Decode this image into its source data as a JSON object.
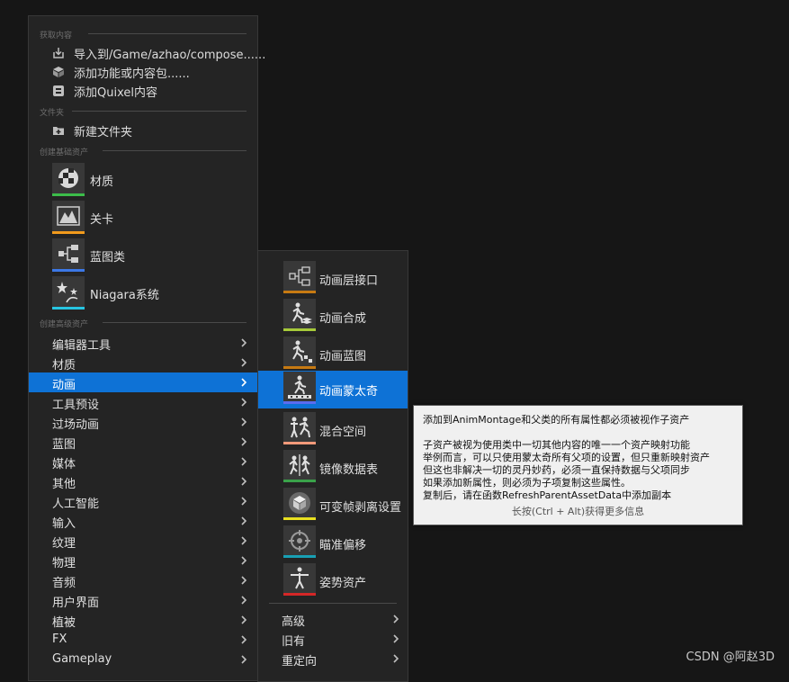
{
  "main_menu": {
    "sections": {
      "get_content": "获取内容",
      "folder": "文件夹",
      "basic_assets": "创建基础资产",
      "advanced_assets": "创建高级资产"
    },
    "get_content_items": [
      {
        "label": "导入到/Game/azhao/compose......",
        "icon": "import-icon"
      },
      {
        "label": "添加功能或内容包......",
        "icon": "feature-pack-icon"
      },
      {
        "label": "添加Quixel内容",
        "icon": "quixel-icon"
      }
    ],
    "folder_items": [
      {
        "label": "新建文件夹",
        "icon": "new-folder-icon"
      }
    ],
    "basic_assets": [
      {
        "label": "材质",
        "icon": "material-icon",
        "color": "#3cbd4a"
      },
      {
        "label": "关卡",
        "icon": "level-icon",
        "color": "#f29b1d"
      },
      {
        "label": "蓝图类",
        "icon": "blueprint-icon",
        "color": "#3c78e6"
      },
      {
        "label": "Niagara系统",
        "icon": "niagara-icon",
        "color": "#27c5e2"
      }
    ],
    "categories": [
      "编辑器工具",
      "材质",
      "动画",
      "工具预设",
      "过场动画",
      "蓝图",
      "媒体",
      "其他",
      "人工智能",
      "输入",
      "纹理",
      "物理",
      "音频",
      "用户界面",
      "植被",
      "FX",
      "Gameplay"
    ],
    "selected_category": "动画"
  },
  "submenu": {
    "items": [
      {
        "label": "动画层接口",
        "icon": "anim-layer-interface-icon",
        "color": "#c77a12"
      },
      {
        "label": "动画合成",
        "icon": "anim-composite-icon",
        "color": "#a6c93a"
      },
      {
        "label": "动画蓝图",
        "icon": "anim-blueprint-icon",
        "color": "#c77a12"
      },
      {
        "label": "动画蒙太奇",
        "icon": "anim-montage-icon",
        "color": "#5a6cf0"
      },
      {
        "label": "混合空间",
        "icon": "blend-space-icon",
        "color": "#f29a7a"
      },
      {
        "label": "镜像数据表",
        "icon": "mirror-table-icon",
        "color": "#3aa24a"
      },
      {
        "label": "可变帧剥离设置",
        "icon": "frame-strip-icon",
        "color": "#e8e020"
      },
      {
        "label": "瞄准偏移",
        "icon": "aim-offset-icon",
        "color": "#18a0b4"
      },
      {
        "label": "姿势资产",
        "icon": "pose-asset-icon",
        "color": "#d52727"
      }
    ],
    "selected": "动画蒙太奇",
    "categories": [
      "高级",
      "旧有",
      "重定向"
    ]
  },
  "tooltip": {
    "title": "添加到AnimMontage和父类的所有属性都必须被视作子资产",
    "body": [
      "子资产被视为使用类中一切其他内容的唯一一个资产映射功能",
      "举例而言，可以只使用蒙太奇所有父项的设置，但只重新映射资产",
      "但这也非解决一切的灵丹妙药，必须一直保持数据与父项同步",
      "如果添加新属性，则必须为子项复制这些属性。",
      "复制后，请在函数RefreshParentAssetData中添加副本"
    ],
    "hint": "长按(Ctrl + Alt)获得更多信息"
  },
  "watermark": "CSDN @阿赵3D",
  "colors": {
    "selection": "#0e72d6",
    "menu_bg": "#242424",
    "background": "#161616"
  }
}
